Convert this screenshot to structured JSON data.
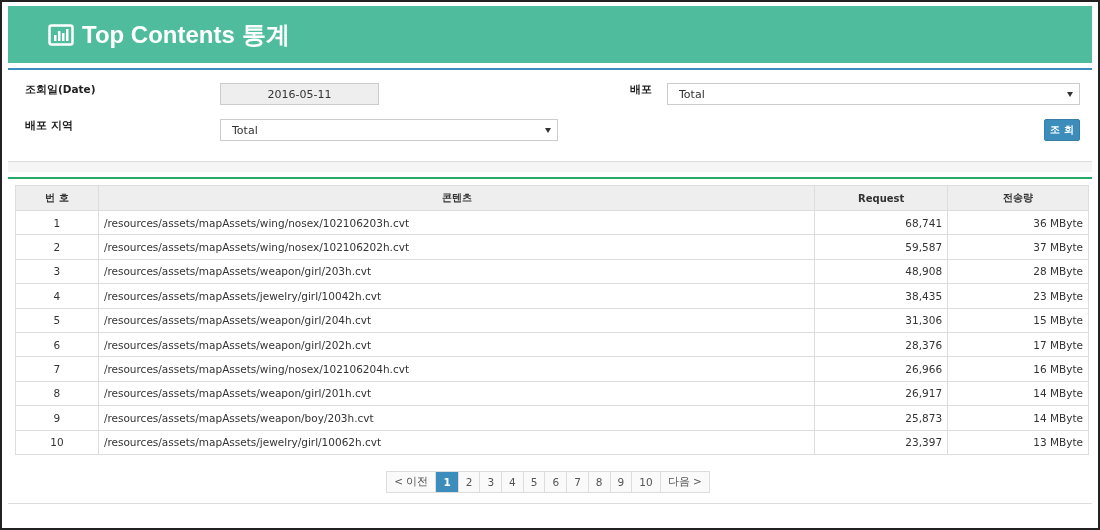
{
  "header": {
    "title": "Top Contents 통계"
  },
  "filters": {
    "date_label": "조회일(Date)",
    "date_value": "2016-05-11",
    "dist_label": "배포",
    "dist_value": "Total",
    "region_label": "배포 지역",
    "region_value": "Total",
    "search_button": "조 회"
  },
  "table": {
    "columns": [
      "번 호",
      "콘텐츠",
      "Request",
      "전송량"
    ],
    "rows": [
      [
        "1",
        "/resources/assets/mapAssets/wing/nosex/102106203h.cvt",
        "68,741",
        "36 MByte"
      ],
      [
        "2",
        "/resources/assets/mapAssets/wing/nosex/102106202h.cvt",
        "59,587",
        "37 MByte"
      ],
      [
        "3",
        "/resources/assets/mapAssets/weapon/girl/203h.cvt",
        "48,908",
        "28 MByte"
      ],
      [
        "4",
        "/resources/assets/mapAssets/jewelry/girl/10042h.cvt",
        "38,435",
        "23 MByte"
      ],
      [
        "5",
        "/resources/assets/mapAssets/weapon/girl/204h.cvt",
        "31,306",
        "15 MByte"
      ],
      [
        "6",
        "/resources/assets/mapAssets/weapon/girl/202h.cvt",
        "28,376",
        "17 MByte"
      ],
      [
        "7",
        "/resources/assets/mapAssets/wing/nosex/102106204h.cvt",
        "26,966",
        "16 MByte"
      ],
      [
        "8",
        "/resources/assets/mapAssets/weapon/girl/201h.cvt",
        "26,917",
        "14 MByte"
      ],
      [
        "9",
        "/resources/assets/mapAssets/weapon/boy/203h.cvt",
        "25,873",
        "14 MByte"
      ],
      [
        "10",
        "/resources/assets/mapAssets/jewelry/girl/10062h.cvt",
        "23,397",
        "13 MByte"
      ]
    ]
  },
  "pagination": {
    "prev": "< 이전",
    "next": "다음 >",
    "pages": [
      {
        "label": "1",
        "selected": true
      },
      {
        "label": "2",
        "selected": false
      },
      {
        "label": "3",
        "selected": false
      },
      {
        "label": "4",
        "selected": false
      },
      {
        "label": "5",
        "selected": false
      },
      {
        "label": "6",
        "selected": false
      },
      {
        "label": "7",
        "selected": false
      },
      {
        "label": "8",
        "selected": false
      },
      {
        "label": "9",
        "selected": false
      },
      {
        "label": "10",
        "selected": false
      }
    ]
  }
}
